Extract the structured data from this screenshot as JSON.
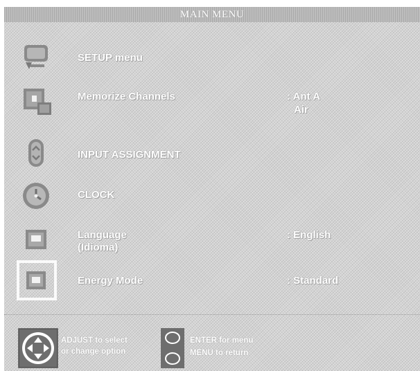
{
  "header": {
    "title": "MAIN MENU"
  },
  "menu": {
    "items": [
      {
        "label": "SETUP menu",
        "icon": "tv-setup-icon"
      },
      {
        "label": "Memorize Channels",
        "value_line1": ": Ant A",
        "value_line2": "Air",
        "icon": "memorize-channels-icon"
      },
      {
        "label": "INPUT ASSIGNMENT",
        "icon": "input-assignment-icon"
      },
      {
        "label": "CLOCK",
        "icon": "clock-icon"
      },
      {
        "label": "Language",
        "label_line2": "(Idioma)",
        "value_line1": ": English",
        "icon": "language-icon"
      },
      {
        "label": "Energy Mode",
        "value_line1": ": Standard",
        "icon": "energy-mode-icon",
        "selected": true
      }
    ]
  },
  "footer": {
    "adjust_line1": "ADJUST to select",
    "adjust_line2": "or  change option",
    "enter_line": "ENTER for menu",
    "menu_line": "MENU  to  return",
    "icons": [
      "dpad-icon",
      "enter-button-icon",
      "menu-button-icon"
    ]
  },
  "colors": {
    "background": "#d4d4d4",
    "title_bar": "#bdbdbd",
    "text": "#ffffff",
    "icon_dark": "#7a7a7a"
  }
}
